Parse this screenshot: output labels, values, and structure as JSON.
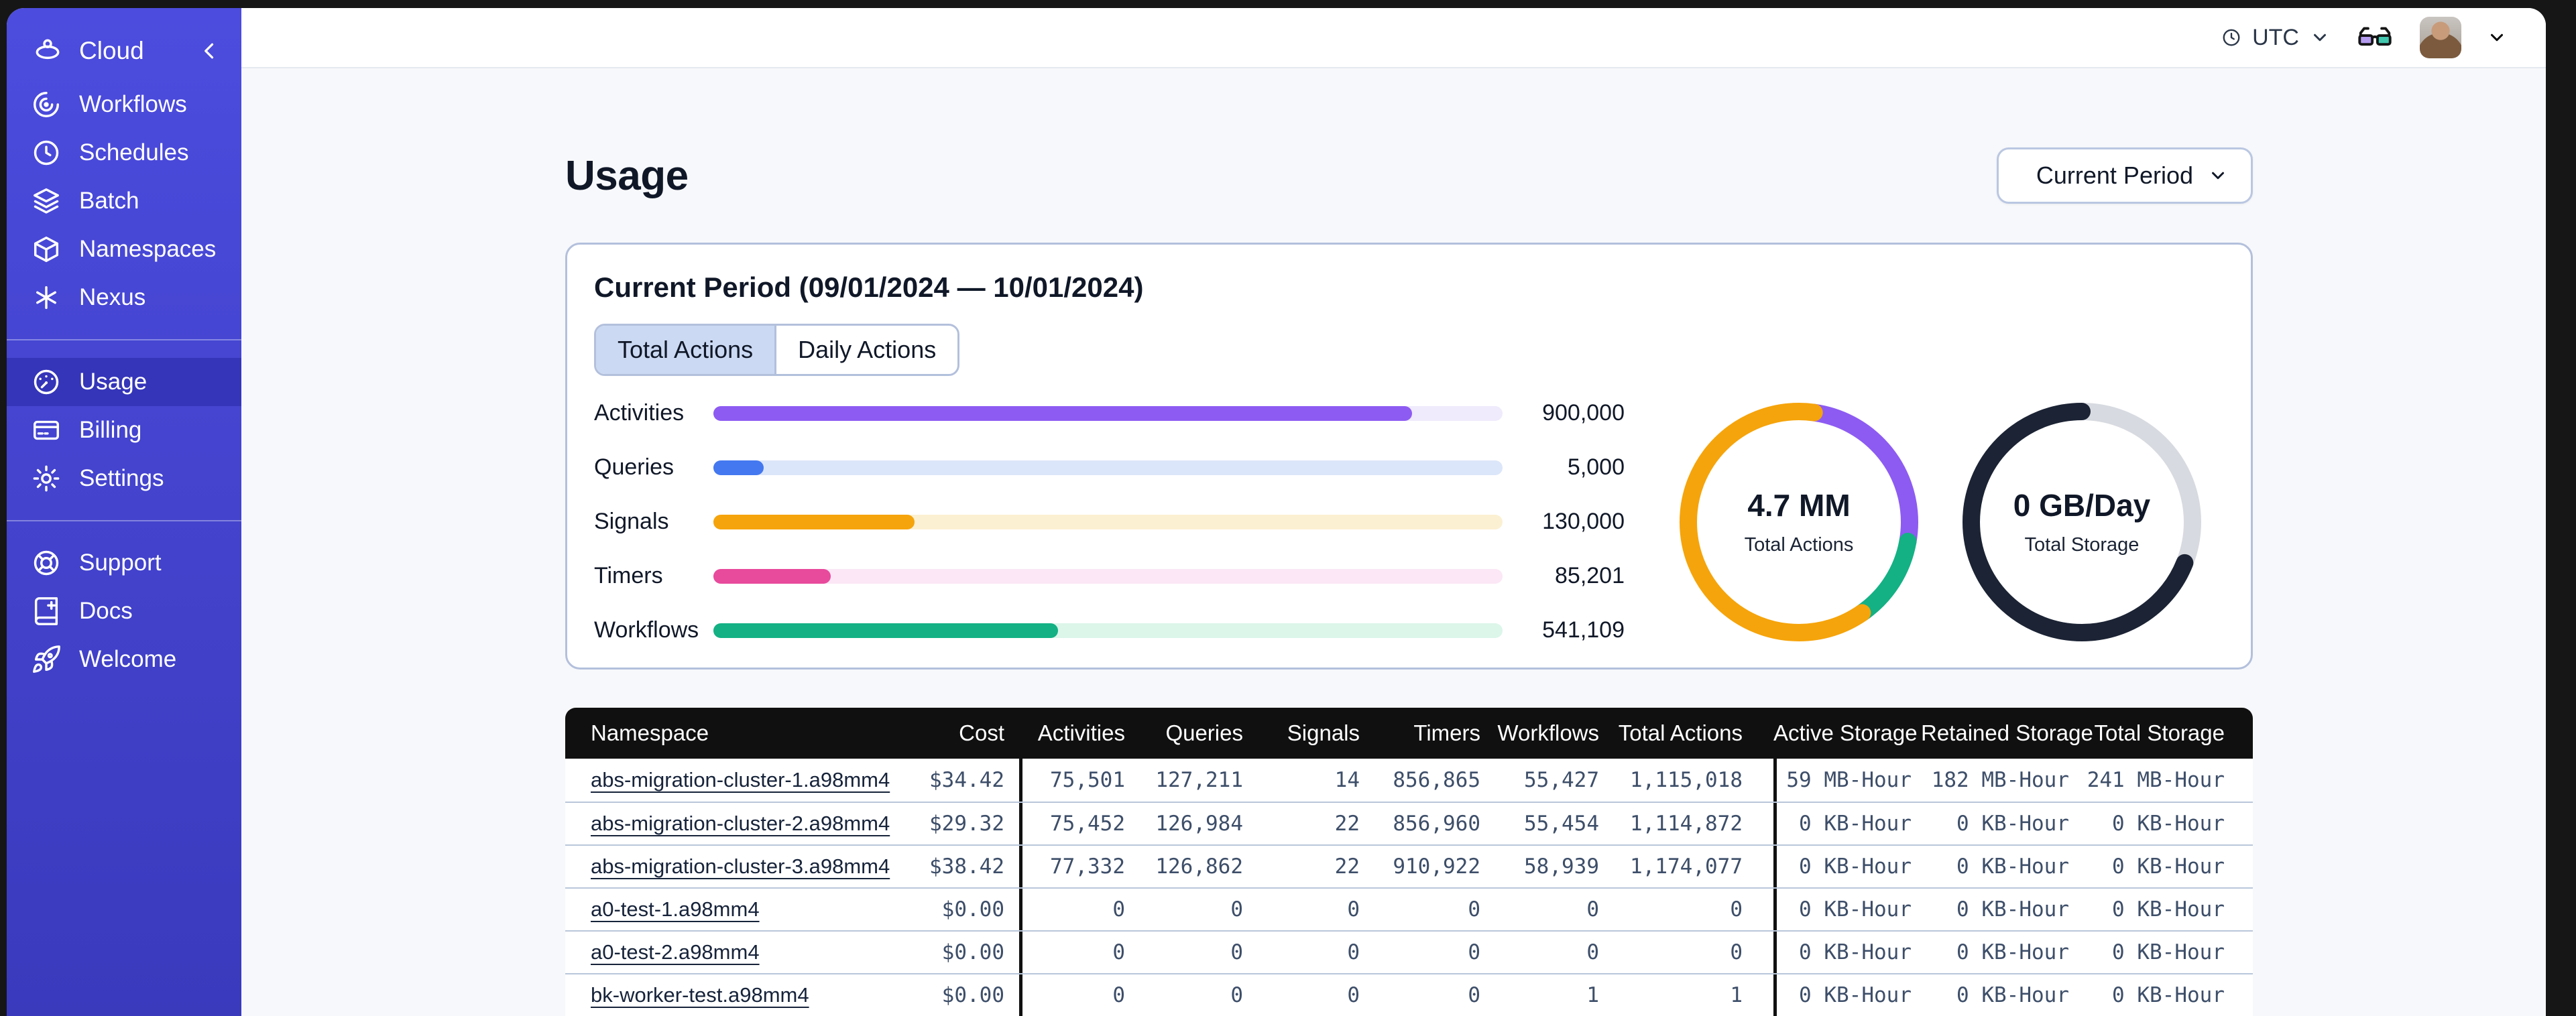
{
  "sidebar": {
    "brand_label": "Cloud",
    "groups": [
      {
        "items": [
          {
            "label": "Workflows",
            "icon": "workflows-icon"
          },
          {
            "label": "Schedules",
            "icon": "schedules-icon"
          },
          {
            "label": "Batch",
            "icon": "batch-icon"
          },
          {
            "label": "Namespaces",
            "icon": "namespaces-icon"
          },
          {
            "label": "Nexus",
            "icon": "nexus-icon"
          }
        ]
      },
      {
        "items": [
          {
            "label": "Usage",
            "icon": "usage-icon",
            "active": true
          },
          {
            "label": "Billing",
            "icon": "billing-icon"
          },
          {
            "label": "Settings",
            "icon": "settings-icon"
          }
        ]
      },
      {
        "items": [
          {
            "label": "Support",
            "icon": "support-icon"
          },
          {
            "label": "Docs",
            "icon": "docs-icon"
          },
          {
            "label": "Welcome",
            "icon": "welcome-icon"
          }
        ]
      }
    ]
  },
  "topbar": {
    "timezone": "UTC"
  },
  "page": {
    "title": "Usage",
    "period_button_label": "Current Period"
  },
  "panel": {
    "title": "Current Period (09/01/2024 — 10/01/2024)",
    "tabs": [
      {
        "label": "Total Actions",
        "active": true
      },
      {
        "label": "Daily Actions",
        "active": false
      }
    ]
  },
  "chart_data": [
    {
      "type": "bar",
      "orientation": "horizontal",
      "categories": [
        "Activities",
        "Queries",
        "Signals",
        "Timers",
        "Workflows"
      ],
      "values": [
        900000,
        5000,
        130000,
        85201,
        541109
      ],
      "value_labels": [
        "900,000",
        "5,000",
        "130,000",
        "85,201",
        "541,109"
      ],
      "fill_fractions": [
        0.885,
        0.064,
        0.255,
        0.149,
        0.437
      ],
      "colors": [
        "#8D5BF2",
        "#4478F0",
        "#F5A40B",
        "#E84A9C",
        "#13B184"
      ],
      "track_colors": [
        "#EFEAFC",
        "#DCE6FA",
        "#FBF0D2",
        "#FBE7F6",
        "#DCF6EA"
      ]
    },
    {
      "type": "donut",
      "center_value": "4.7 MM",
      "center_label": "Total Actions",
      "segments": [
        {
          "name": "purple-segment",
          "color": "#8D5BF2",
          "start": 0.022,
          "fraction": 0.256
        },
        {
          "name": "green-segment",
          "color": "#13B184",
          "start": 0.278,
          "fraction": 0.125
        },
        {
          "name": "orange-segment",
          "color": "#F5A40B",
          "start": 0.403,
          "fraction": 0.619
        }
      ]
    },
    {
      "type": "donut",
      "center_value": "0 GB/Day",
      "center_label": "Total Storage",
      "track_color": "#D7DAE0",
      "segments": [
        {
          "name": "dark-segment",
          "color": "#1B2334",
          "start": 0.31,
          "fraction": 0.69
        }
      ]
    }
  ],
  "table": {
    "columns": [
      "Namespace",
      "Cost",
      "Activities",
      "Queries",
      "Signals",
      "Timers",
      "Workflows",
      "Total Actions",
      "Active Storage",
      "Retained Storage",
      "Total Storage"
    ],
    "rows": [
      [
        "abs-migration-cluster-1.a98mm4",
        "$34.42",
        "75,501",
        "127,211",
        "14",
        "856,865",
        "55,427",
        "1,115,018",
        "59 MB-Hour",
        "182 MB-Hour",
        "241 MB-Hour"
      ],
      [
        "abs-migration-cluster-2.a98mm4",
        "$29.32",
        "75,452",
        "126,984",
        "22",
        "856,960",
        "55,454",
        "1,114,872",
        "0 KB-Hour",
        "0 KB-Hour",
        "0 KB-Hour"
      ],
      [
        "abs-migration-cluster-3.a98mm4",
        "$38.42",
        "77,332",
        "126,862",
        "22",
        "910,922",
        "58,939",
        "1,174,077",
        "0 KB-Hour",
        "0 KB-Hour",
        "0 KB-Hour"
      ],
      [
        "a0-test-1.a98mm4",
        "$0.00",
        "0",
        "0",
        "0",
        "0",
        "0",
        "0",
        "0 KB-Hour",
        "0 KB-Hour",
        "0 KB-Hour"
      ],
      [
        "a0-test-2.a98mm4",
        "$0.00",
        "0",
        "0",
        "0",
        "0",
        "0",
        "0",
        "0 KB-Hour",
        "0 KB-Hour",
        "0 KB-Hour"
      ],
      [
        "bk-worker-test.a98mm4",
        "$0.00",
        "0",
        "0",
        "0",
        "0",
        "1",
        "1",
        "0 KB-Hour",
        "0 KB-Hour",
        "0 KB-Hour"
      ]
    ],
    "colors": {
      "header_bg": "#101010",
      "cell_text": "#3D4E69",
      "row_divider": "#B9C6DA"
    }
  },
  "colors": {
    "sidebar_top": "#4C4CDE",
    "sidebar_bottom": "#3A3ABD",
    "accent_purple": "#8D5BF2",
    "accent_blue": "#4478F0",
    "accent_orange": "#F5A40B",
    "accent_pink": "#E84A9C",
    "accent_green": "#13B184",
    "storage_dark": "#1B2334",
    "panel_border": "#B3C0DC",
    "tab_active_bg": "#CBD9F2",
    "content_bg": "#F7F8FB"
  }
}
